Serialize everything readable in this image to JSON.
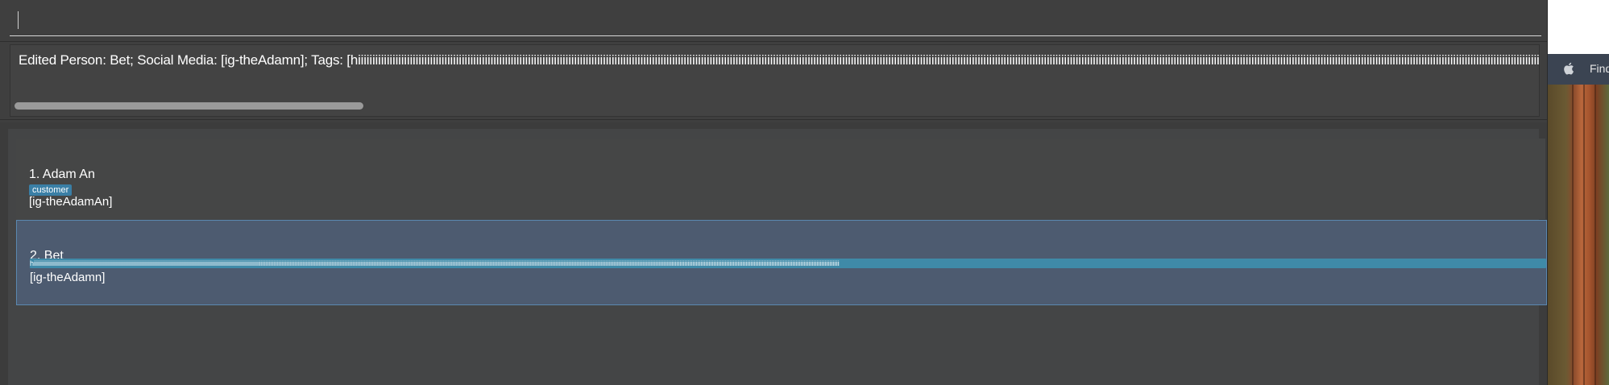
{
  "command_box": {
    "value": "",
    "placeholder": ""
  },
  "result_display": {
    "text": "Edited Person: Bet; Social Media: [ig-theAdamn]; Tags: [hiiiiiiiiiiiiiiiiiiiiiiiiiiiiiiiiiiiiiiiiiiiiiiiiiiiiiiiiiiiiiiiiiiiiiiiiiiiiiiiiiiiiiiiiiiiiiiiiiiiiiiiiiiiiiiiiiiiiiiiiiiiiiiiiiiiiiiiiiiiiiiiiiiiiiiiiiiiiiiiiiiiiiiiiiiiiiiiiiiiiiiiiiiiiiiiiiiiiiiiiiiiiiiiiiiiiiiiiiiiiiiiiiiiiiiiiiiiiiiiiiiiiiiiiiiiiiiiiiiiiiiiiiiiiiiiiiiiiiiiiiiiiiiiiiiiiiiiiiiiiiiiiiiiiiiiiiiiiiiiiiiiiiiiiiiiiiiiiiiiiiiiiiiiiiiiiiiiiiiiiiiiiiiiiiiiiiiiiiiiiiiiiiiiiiiiiiiiiiiiiiiiiiiiiiiiiiiiiiiiiiiiiiiiiiiiiiiiiiiiiiiiiii"
  },
  "persons": [
    {
      "index_name": "1. Adam An",
      "tag": "customer",
      "social": "[ig-theAdamAn]"
    },
    {
      "index_name": "2. Bet",
      "tag": "hiiiiiiiiiiiiiiiiiiiiiiiiiiiiiiiiiiiiiiiiiiiiiiiiiiiiiiiiiiiiiiiiiiiiiiiiiiiiiiiiiiiiiiiiiiiiiiiiiiiiiiiiiiiiiiiiiiiiiiiiiiiiiiiiiiiiiiiiiiiiiiiiiiiiiiiiiiiiiiiiiiiiiiiiiiiiiiiiiiiiiiiiiiiiiiiiiiiiiiiiiiiiiiiiiiiiiiiiiiiiiiiiiiiiiiiiiiiiiiiiiiiiiiiiiiiiiiiiiiiiiiiiiiiiiiiiiiiiiiiiiiiiiiiiiiiiiiiiiiiiiiiiiiiiiiiiiiiiiiiiiiiiiiiiiiiiiiiiiiiiiiiiiiiiiiiiiiiiiiiiiiiiiiiiiiiiiiiiiiiiiiiiiiiiiiiiiiiiiiiiiiiiiiiiiiiiiiiiiiiiiiiiiiiiiiiiiiiiiiiiiiiiiiiiiiiiiiiiiiiiiiiiiiiiiiiiiiiiiiiiiiiiiiiiiiiiiiiiiiii",
      "social": "[ig-theAdamn]",
      "selected": true
    }
  ],
  "desktop": {
    "menu_label": "Find"
  },
  "colors": {
    "app_bg": "#3f3f3f",
    "selected_card_bg": "#4d5b70",
    "tag_bg": "#3a7fa6"
  },
  "icons": [
    "apple-icon"
  ]
}
